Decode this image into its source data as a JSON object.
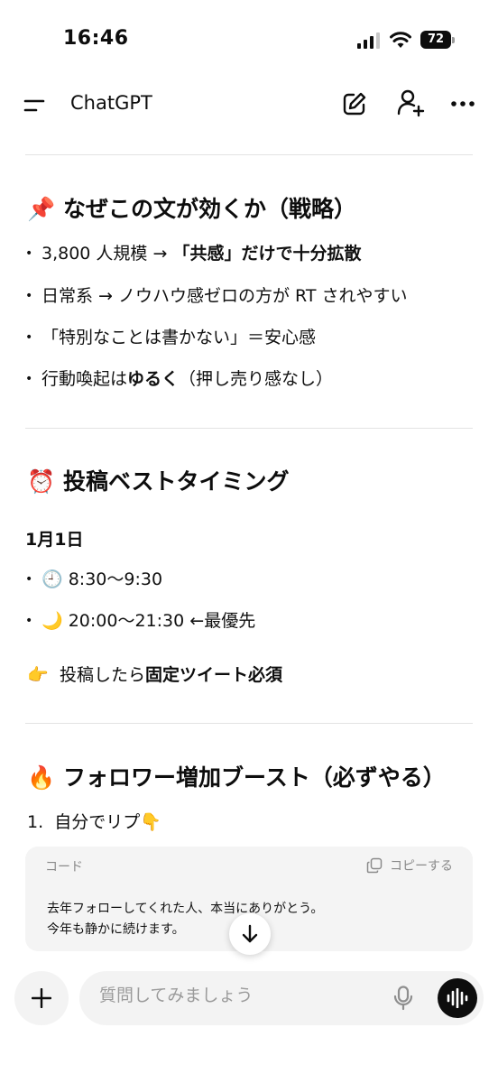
{
  "status_bar": {
    "time": "16:46",
    "battery": "72"
  },
  "header": {
    "title": "ChatGPT"
  },
  "section1": {
    "emoji": "📌",
    "title": "なぜこの文が効くか（戦略）",
    "bullets": [
      {
        "plain": "3,800 人規模 → ",
        "bold": "「共感」だけで十分拡散",
        "after": ""
      },
      {
        "plain": "日常系 → ノウハウ感ゼロの方が RT されやすい",
        "bold": "",
        "after": ""
      },
      {
        "plain": "「特別なことは書かない」＝安心感",
        "bold": "",
        "after": ""
      },
      {
        "plain": "行動喚起は",
        "bold": "ゆるく",
        "after": "（押し売り感なし）"
      }
    ]
  },
  "section2": {
    "emoji": "⏰",
    "title": "投稿ベストタイミング",
    "date": "1月1日",
    "slots": [
      {
        "emoji": "🕘",
        "text": "8:30〜9:30"
      },
      {
        "emoji": "🌙",
        "text": "20:00〜21:30 ←最優先"
      }
    ],
    "note": {
      "emoji": "👉",
      "plain": "投稿したら",
      "bold": "固定ツイート必須"
    }
  },
  "section3": {
    "emoji": "🔥",
    "title": "フォロワー増加ブースト（必ずやる）",
    "step1": {
      "num": "1.",
      "text": "自分でリプ",
      "emoji": "👇"
    }
  },
  "code_block": {
    "lang": "コード",
    "copy_label": "コピーする",
    "lines": [
      "去年フォローしてくれた人、本当にありがとう。",
      "今年も静かに続けます。"
    ]
  },
  "composer": {
    "placeholder": "質問してみましょう"
  },
  "colors": {
    "text": "#0d0d0d",
    "divider": "#e3e3e3",
    "code_bg": "#f4f4f4",
    "composer_bg": "#f3f3f3",
    "accent_dark": "#0d0d0d"
  },
  "icons": [
    "signal-icon",
    "wifi-icon",
    "battery-icon",
    "menu-icon",
    "edit-icon",
    "add-user-icon",
    "more-icon",
    "copy-icon",
    "arrow-down-icon",
    "plus-icon",
    "mic-icon",
    "voice-wave-icon"
  ]
}
